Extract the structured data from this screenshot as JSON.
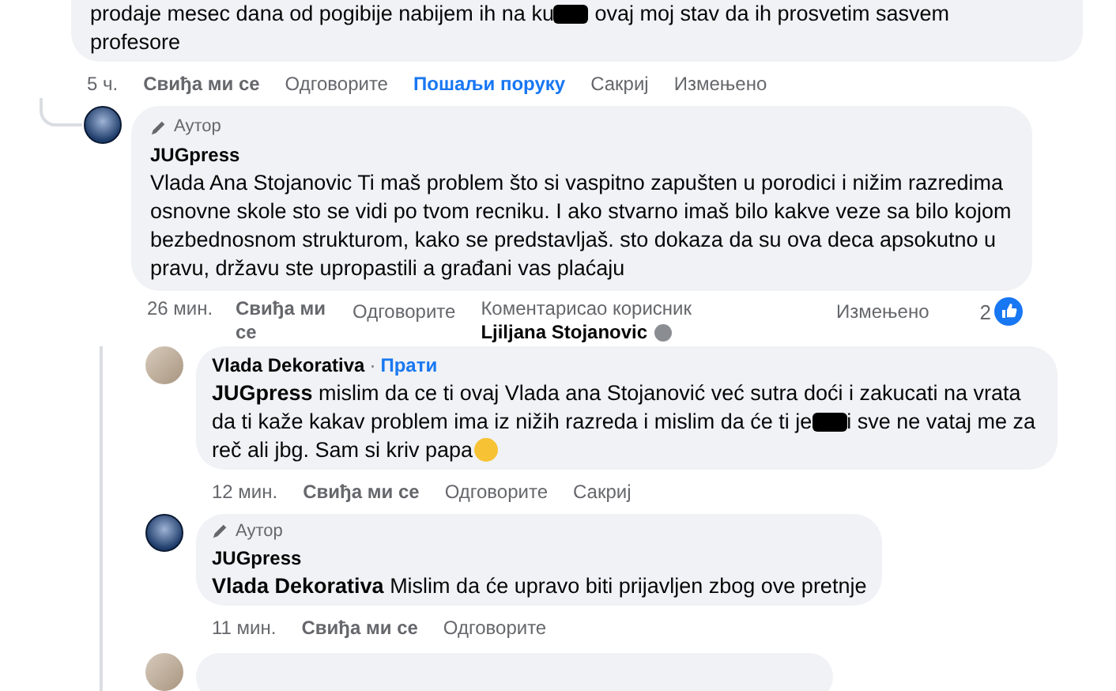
{
  "thread": {
    "body": [
      {
        "kind": "text",
        "text": "prodaje mesec dana od pogibije nabijem ih na ku"
      },
      {
        "kind": "redacted"
      },
      {
        "kind": "text",
        "text": " ovaj moj stav da ih prosvetim sasvem profesore"
      }
    ],
    "actions": [
      {
        "kind": "time",
        "label": "5 ч."
      },
      {
        "kind": "like",
        "label": "Свиђа ми се"
      },
      {
        "kind": "plain",
        "label": "Одговорите"
      },
      {
        "kind": "link",
        "label": "Пошаљи поруку"
      },
      {
        "kind": "plain",
        "label": "Сакриј"
      },
      {
        "kind": "plain",
        "label": "Измењено"
      }
    ],
    "replies": [
      {
        "kind": "comment",
        "page_avatar": true,
        "badge": "Аутор",
        "author": "JUGpress",
        "body": [
          {
            "kind": "text",
            "text": "Vlada Ana Stojanovic Ti maš problem što si vaspitno zapušten u porodici i nižim razredima osnovne skole sto se vidi po tvom recniku. I ako stvarno imaš bilo kakve veze sa bilo kojom bezbednosnom strukturom, kako se predstavljaš. sto dokaza da su ova deca apsokutno u pravu, državu ste upropastili a građani vas plaćaju"
          }
        ],
        "actions": [
          {
            "kind": "time",
            "label": "26 мин."
          },
          {
            "kind": "like",
            "label": "Свиђа ми се"
          },
          {
            "kind": "plain",
            "label": "Одговорите"
          },
          {
            "kind": "attribution",
            "label": "Коментарисао корисник",
            "name": "Ljiljana Stojanovic"
          },
          {
            "kind": "edited",
            "label": "Измењено"
          }
        ],
        "reactions": "2",
        "children": [
          {
            "kind": "comment",
            "page_avatar": false,
            "author": "Vlada Dekorativa",
            "separator": "·",
            "follow": "Прати",
            "body": [
              {
                "kind": "text",
                "text": "**JUGpress** mislim da ce ti ovaj Vlada ana Stojanović već sutra doći i zakucati na vrata da ti kaže kakav problem ima iz nižih razreda i mislim da će ti je"
              },
              {
                "kind": "redacted"
              },
              {
                "kind": "text",
                "text": "i sve ne vataj me za reč ali jbg. Sam si kriv papa"
              },
              {
                "kind": "emoji"
              }
            ],
            "actions": [
              {
                "kind": "time",
                "label": "12 мин."
              },
              {
                "kind": "like",
                "label": "Свиђа ми се"
              },
              {
                "kind": "plain",
                "label": "Одговорите"
              },
              {
                "kind": "plain",
                "label": "Сакриј"
              }
            ]
          },
          {
            "kind": "comment",
            "page_avatar": true,
            "badge": "Аутор",
            "author": "JUGpress",
            "body": [
              {
                "kind": "text",
                "text": "**Vlada Dekorativa** Mislim da će upravo biti prijavljen zbog ove pretnje"
              }
            ],
            "actions": [
              {
                "kind": "time",
                "label": "11 мин."
              },
              {
                "kind": "like",
                "label": "Свиђа ми се"
              },
              {
                "kind": "plain",
                "label": "Одговорите"
              }
            ]
          },
          {
            "kind": "cut",
            "page_avatar": false
          }
        ]
      }
    ]
  }
}
